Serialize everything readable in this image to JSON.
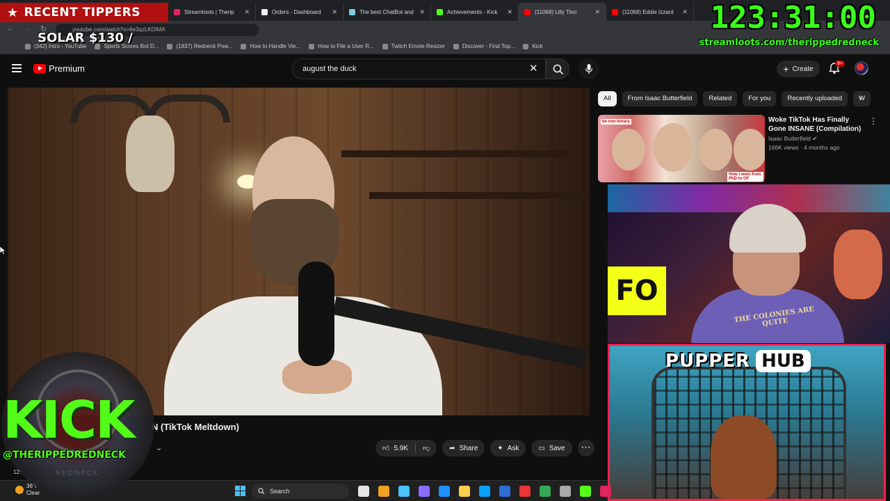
{
  "browser": {
    "tabs": [
      {
        "title": "Streamloots | Therip",
        "color": "#e0245e"
      },
      {
        "title": "Orders - Dashboard",
        "color": "#eeeeee"
      },
      {
        "title": "The best ChatBot and",
        "color": "#7ec8e3"
      },
      {
        "title": "Achievements - Kick",
        "color": "#53fc18"
      },
      {
        "title": "(11068) Lilly Tino",
        "color": "#ff0000",
        "active": true
      },
      {
        "title": "(11068) Eddie Izzard",
        "color": "#ff0000"
      }
    ],
    "url": "youtube.com/watch?v=6e3qzLKDIMA",
    "bookmarks": [
      "(342) Intro - YouTube",
      "Sports Scores Bot D...",
      "(1837) Redneck Pow...",
      "How to Handle Vie...",
      "How to File a User R...",
      "Twitch Emote Resizer",
      "Discover - Find Top...",
      "Kick"
    ]
  },
  "overlay": {
    "recent_tippers_label": "RECENT TIPPERS",
    "tipper_entry": "SOLAR $130 /",
    "timer": "123:31:00",
    "streamloots_url": "streamloots.com/therippedredneck",
    "kick_word": "KICK",
    "kick_handle": "@THERIPPEDREDNECK",
    "kick_sub": "REDNECK",
    "pupper_word1": "PUPPER",
    "pupper_word2": "HUB",
    "cam_shirt_text": "THE COLONIES ARE QUITE",
    "cam_neon_text": "FO"
  },
  "youtube": {
    "logo_text": "Premium",
    "search_query": "august the duck",
    "create_label": "Create",
    "notif_badge": "9+",
    "video_title_partial": "N (TikTok Meltdown)",
    "like_count": "5.9K",
    "share_label": "Share",
    "ask_label": "Ask",
    "save_label": "Save",
    "chips": [
      "All",
      "From Isaac Butterfield",
      "Related",
      "For you",
      "Recently uploaded",
      "W"
    ],
    "related": {
      "title": "Woke TikTok Has Finally Gone INSANE (Compilation)",
      "channel": "Isaac Butterfield",
      "meta": "166K views · 4 months ago",
      "thumb_caption_left": "be non-binary",
      "thumb_caption_right": "How I went from PhD to OF"
    }
  },
  "taskbar": {
    "temp": "36°F",
    "condition": "Clear",
    "search_label": "Search",
    "partial_time": "12:",
    "app_colors": [
      "#e6e6e6",
      "#f0a020",
      "#4cc2ff",
      "#8a6cff",
      "#1e90ff",
      "#ffd04c",
      "#0aa0ff",
      "#2f6dd9",
      "#e33",
      "#34a853",
      "#aaa",
      "#53fc18",
      "#e0245e"
    ]
  }
}
